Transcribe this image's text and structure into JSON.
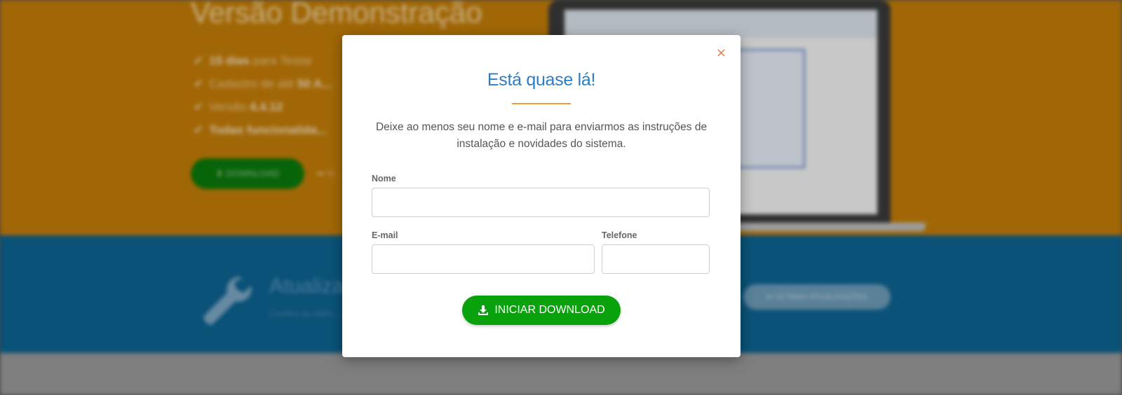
{
  "background": {
    "hero": {
      "title": "Versão Demonstração",
      "features": [
        {
          "bold": "15 dias",
          "text": " para Testar"
        },
        {
          "text": "Cadastro de até ",
          "bold": "50 A..."
        },
        {
          "text": "Versão ",
          "bold": "4.4.12"
        },
        {
          "bold": "Todas funcionalida..."
        }
      ],
      "download_label": "DOWNLOAD",
      "secondary_link": "V..."
    },
    "updates": {
      "title": "Atualizaç...",
      "subtitle": "Confira as últim...",
      "button_label": "ÚLTIMAS ATUALIZAÇÕES"
    },
    "colors": {
      "hero_bg": "#c57e08",
      "updates_bg": "#0d6492"
    }
  },
  "modal": {
    "close_symbol": "×",
    "title": "Está quase lá!",
    "description": "Deixe ao menos seu nome e e-mail para enviarmos as instruções de instalação e novidades do sistema.",
    "fields": {
      "nome": {
        "label": "Nome",
        "value": ""
      },
      "email": {
        "label": "E-mail",
        "value": ""
      },
      "telefone": {
        "label": "Telefone",
        "value": ""
      }
    },
    "submit_label": "INICIAR DOWNLOAD",
    "submit_icon": "download-icon",
    "colors": {
      "title": "#2b7dc6",
      "accent_rule": "#e4a336",
      "close": "#e07b54",
      "submit_bg": "#09a20d"
    }
  }
}
